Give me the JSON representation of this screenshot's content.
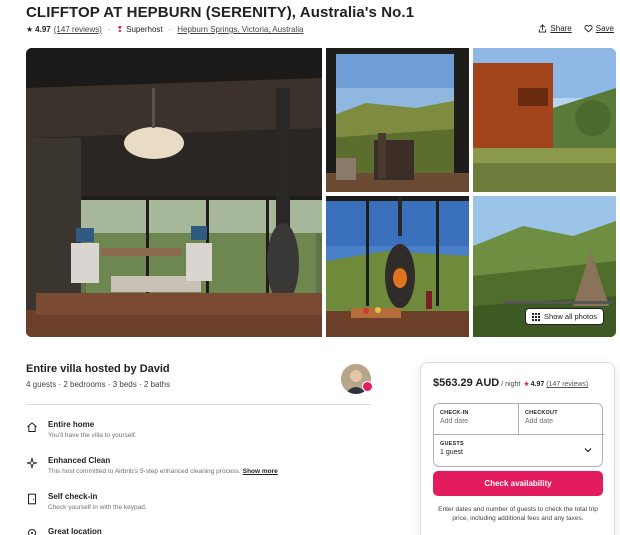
{
  "listing": {
    "title": "CLIFFTOP AT HEPBURN (SERENITY), Australia's No.1",
    "rating": "4.97",
    "reviews_link": "(147 reviews)",
    "superhost": "Superhost",
    "location": "Hepburn Springs, Victoria, Australia",
    "share_label": "Share",
    "save_label": "Save"
  },
  "gallery": {
    "show_all_label": "Show all photos"
  },
  "host": {
    "title": "Entire villa hosted by David",
    "summary": "4 guests · 2 bedrooms · 3 beds · 2 baths"
  },
  "features": [
    {
      "icon": "home-icon",
      "title": "Entire home",
      "desc": "You'll have the villa to yourself."
    },
    {
      "icon": "sparkle-icon",
      "title": "Enhanced Clean",
      "desc": "This host committed to Airbnb's 5-step enhanced cleaning process.",
      "more": "Show more"
    },
    {
      "icon": "door-icon",
      "title": "Self check-in",
      "desc": "Check yourself in with the keypad."
    },
    {
      "icon": "location-pin-icon",
      "title": "Great location",
      "desc": ""
    }
  ],
  "booking": {
    "price": "$563.29 AUD",
    "per_night": "/ night",
    "rating": "4.97",
    "reviews_link": "(147 reviews)",
    "checkin_label": "CHECK-IN",
    "checkin_value": "Add date",
    "checkout_label": "CHECKOUT",
    "checkout_value": "Add date",
    "guests_label": "GUESTS",
    "guests_value": "1 guest",
    "cta_label": "Check availability",
    "note": "Enter dates and number of guests to check the total trip price, including additional fees and any taxes."
  },
  "colors": {
    "accent": "#e31c5f",
    "text": "#222222",
    "muted": "#717171",
    "border": "#dddddd"
  }
}
